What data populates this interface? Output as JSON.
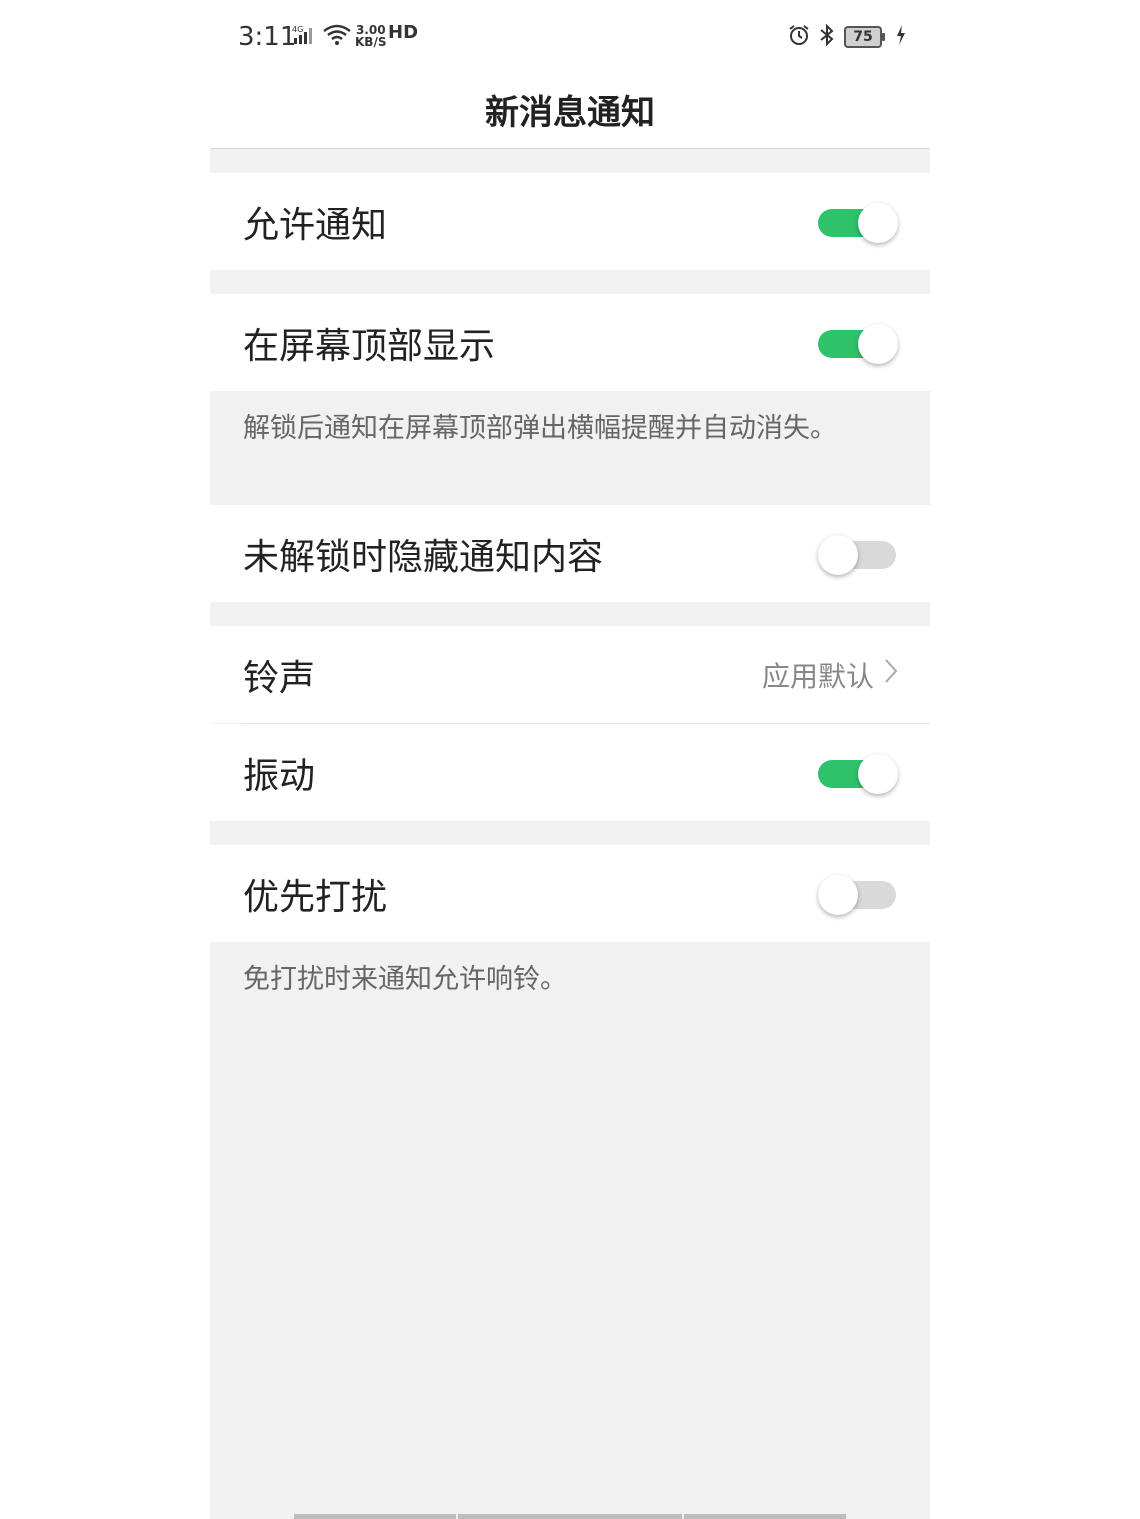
{
  "status_bar": {
    "time": "3:11",
    "network": "4G",
    "speed_value": "3.00",
    "speed_unit": "KB/S",
    "hd": "HD",
    "battery": "75"
  },
  "header": {
    "title": "新消息通知"
  },
  "settings": {
    "allow_notifications": {
      "label": "允许通知",
      "enabled": true
    },
    "show_on_top": {
      "label": "在屏幕顶部显示",
      "enabled": true,
      "description": "解锁后通知在屏幕顶部弹出横幅提醒并自动消失。"
    },
    "hide_content_locked": {
      "label": "未解锁时隐藏通知内容",
      "enabled": false
    },
    "ringtone": {
      "label": "铃声",
      "value": "应用默认"
    },
    "vibrate": {
      "label": "振动",
      "enabled": true
    },
    "priority": {
      "label": "优先打扰",
      "enabled": false,
      "description": "免打扰时来通知允许响铃。"
    }
  },
  "colors": {
    "toggle_on": "#2ec36b",
    "toggle_off": "#d9d9d9",
    "background": "#f1f1f1"
  }
}
